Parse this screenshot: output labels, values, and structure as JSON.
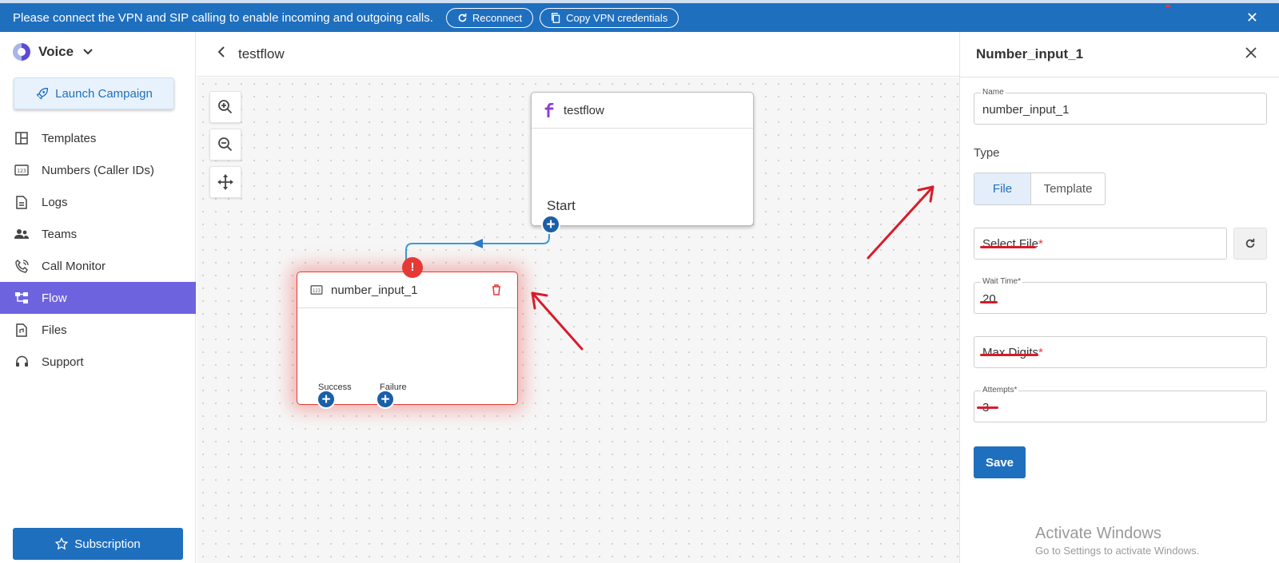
{
  "banner": {
    "message": "Please connect the VPN and SIP calling to enable incoming and outgoing calls.",
    "reconnect_label": "Reconnect",
    "copy_vpn_label": "Copy VPN credentials",
    "close_glyph": "✕"
  },
  "sidebar": {
    "brand": "Voice",
    "launch_label": "Launch Campaign",
    "items": [
      {
        "label": "Templates",
        "icon": "templates-icon"
      },
      {
        "label": "Numbers (Caller IDs)",
        "icon": "numbers-icon"
      },
      {
        "label": "Logs",
        "icon": "logs-icon"
      },
      {
        "label": "Teams",
        "icon": "teams-icon"
      },
      {
        "label": "Call Monitor",
        "icon": "call-monitor-icon"
      },
      {
        "label": "Flow",
        "icon": "flow-icon",
        "active": true
      },
      {
        "label": "Files",
        "icon": "files-icon"
      },
      {
        "label": "Support",
        "icon": "support-icon"
      }
    ],
    "subscription_label": "Subscription"
  },
  "header": {
    "title": "testflow"
  },
  "canvas": {
    "start_node": {
      "title": "testflow",
      "start_label": "Start"
    },
    "number_node": {
      "title": "number_input_1",
      "success_label": "Success",
      "failure_label": "Failure",
      "alert_glyph": "!"
    }
  },
  "panel": {
    "title": "Number_input_1",
    "name": {
      "label": "Name",
      "value": "number_input_1"
    },
    "type_label": "Type",
    "type_options": [
      "File",
      "Template"
    ],
    "select_file": {
      "placeholder": "Select File",
      "required": "*"
    },
    "wait_time": {
      "label": "Wait Time*",
      "value": "20"
    },
    "max_digits": {
      "placeholder": "Max Digits",
      "required": "*"
    },
    "attempts": {
      "label": "Attempts*",
      "value": "3"
    },
    "save_label": "Save"
  },
  "watermark": {
    "line1": "Activate Windows",
    "line2": "Go to Settings to activate Windows."
  },
  "colors": {
    "brand_blue": "#1f6fbf",
    "active_nav": "#6e63de",
    "error_red": "#e53935",
    "annotation_red": "#d81b2b"
  }
}
